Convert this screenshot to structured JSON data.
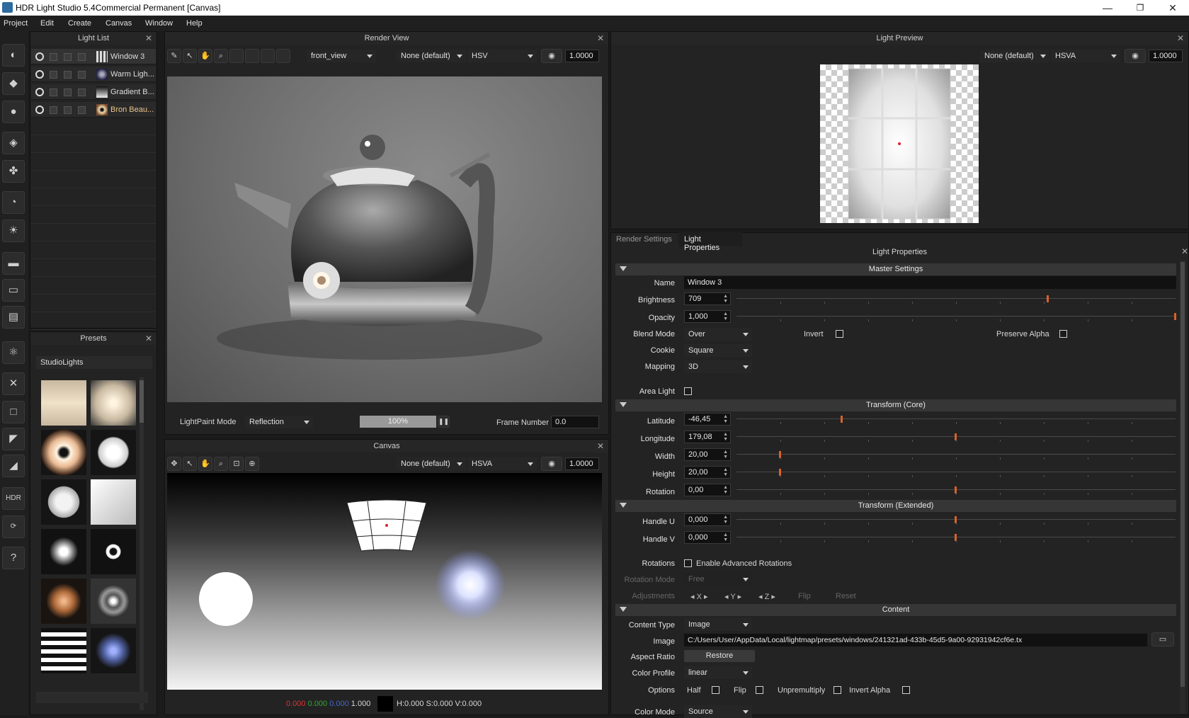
{
  "window": {
    "title": "HDR Light Studio 5.4Commercial Permanent [Canvas]",
    "minimize": "—",
    "restore": "❐",
    "close": "✕"
  },
  "menu": [
    "Project",
    "Edit",
    "Create",
    "Canvas",
    "Window",
    "Help"
  ],
  "light_list": {
    "title": "Light List",
    "items": [
      {
        "label": "Window 3",
        "selected": true
      },
      {
        "label": "Warm Ligh..."
      },
      {
        "label": "Gradient B..."
      },
      {
        "label": "Bron Beau...",
        "highlight": true
      }
    ]
  },
  "presets": {
    "title": "Presets",
    "category": "StudioLights"
  },
  "render_view": {
    "title": "Render View",
    "camera": "front_view",
    "lut": "None (default)",
    "color_mode": "HSV",
    "exposure": "1.0000",
    "lightpaint_label": "LightPaint Mode",
    "lightpaint_value": "Reflection",
    "progress": "100%",
    "progress_fraction": 1.0,
    "frame_label": "Frame Number",
    "frame_value": "0.0"
  },
  "canvas": {
    "title": "Canvas",
    "lut": "None (default)",
    "color_mode": "HSVA",
    "exposure": "1.0000",
    "status": {
      "r": "0.000",
      "g": "0.000",
      "b": "0.000",
      "a": "1.000",
      "hsv": "H:0.000 S:0.000 V:0.000"
    }
  },
  "light_preview": {
    "title": "Light Preview",
    "lut": "None (default)",
    "color_mode": "HSVA",
    "exposure": "1.0000"
  },
  "props": {
    "tabs": [
      "Render Settings",
      "Light Properties"
    ],
    "active_tab": "Light Properties",
    "title": "Light Properties",
    "master": {
      "title": "Master Settings",
      "name_label": "Name",
      "name": "Window 3",
      "brightness_label": "Brightness",
      "brightness": "709",
      "brightness_frac": 0.71,
      "opacity_label": "Opacity",
      "opacity": "1,000",
      "opacity_frac": 1.0,
      "blend_label": "Blend Mode",
      "blend": "Over",
      "invert_label": "Invert",
      "preserve_alpha_label": "Preserve Alpha",
      "cookie_label": "Cookie",
      "cookie": "Square",
      "mapping_label": "Mapping",
      "mapping": "3D",
      "area_light_label": "Area Light"
    },
    "transform_core": {
      "title": "Transform (Core)",
      "latitude_label": "Latitude",
      "latitude": "-46,45",
      "latitude_frac": 0.24,
      "longitude_label": "Longitude",
      "longitude": "179,08",
      "longitude_frac": 0.5,
      "width_label": "Width",
      "width": "20,00",
      "width_frac": 0.1,
      "height_label": "Height",
      "height": "20,00",
      "height_frac": 0.1,
      "rotation_label": "Rotation",
      "rotation": "0,00",
      "rotation_frac": 0.5
    },
    "transform_ext": {
      "title": "Transform (Extended)",
      "handle_u_label": "Handle U",
      "handle_u": "0,000",
      "handle_u_frac": 0.5,
      "handle_v_label": "Handle V",
      "handle_v": "0,000",
      "handle_v_frac": 0.5,
      "rotations_label": "Rotations",
      "enable_adv": "Enable Advanced Rotations",
      "rotation_mode_label": "Rotation Mode",
      "rotation_mode": "Free",
      "adjustments_label": "Adjustments",
      "x": "X",
      "y": "Y",
      "z": "Z",
      "flip": "Flip",
      "reset": "Reset"
    },
    "content": {
      "title": "Content",
      "type_label": "Content Type",
      "type": "Image",
      "image_label": "Image",
      "image_path": "C:/Users/User/AppData/Local/lightmap/presets/windows/241321ad-433b-45d5-9a00-92931942cf6e.tx",
      "aspect_label": "Aspect Ratio",
      "restore": "Restore",
      "color_profile_label": "Color Profile",
      "color_profile": "linear",
      "options_label": "Options",
      "half": "Half",
      "flip": "Flip",
      "unpremultiply": "Unpremultiply",
      "invert_alpha": "Invert Alpha",
      "color_mode_label": "Color Mode",
      "color_mode": "Source"
    }
  },
  "colors": {
    "accent": "#d9622b",
    "selected_highlight": "#e8c58a"
  }
}
